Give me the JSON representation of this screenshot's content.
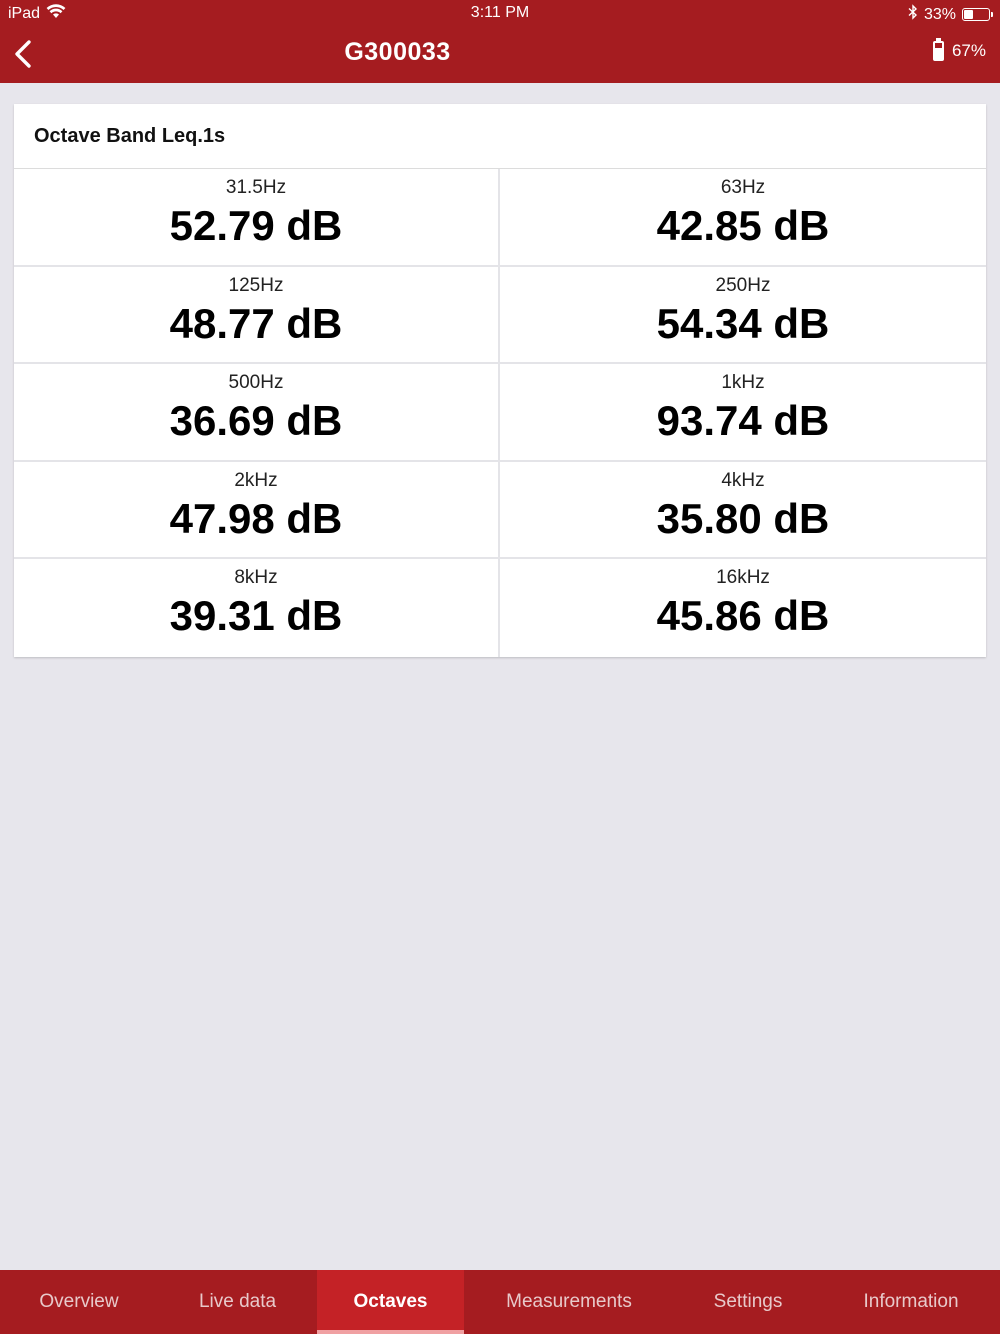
{
  "status_bar": {
    "device": "iPad",
    "time": "3:11 PM",
    "battery_text": "33%",
    "battery_level": 0.33
  },
  "nav": {
    "title": "G300033",
    "device_battery": "67%"
  },
  "card": {
    "title": "Octave Band Leq.1s",
    "bands": [
      {
        "freq": "31.5Hz",
        "level": "52.79 dB"
      },
      {
        "freq": "63Hz",
        "level": "42.85 dB"
      },
      {
        "freq": "125Hz",
        "level": "48.77 dB"
      },
      {
        "freq": "250Hz",
        "level": "54.34 dB"
      },
      {
        "freq": "500Hz",
        "level": "36.69 dB"
      },
      {
        "freq": "1kHz",
        "level": "93.74 dB"
      },
      {
        "freq": "2kHz",
        "level": "47.98 dB"
      },
      {
        "freq": "4kHz",
        "level": "35.80 dB"
      },
      {
        "freq": "8kHz",
        "level": "39.31 dB"
      },
      {
        "freq": "16kHz",
        "level": "45.86 dB"
      }
    ]
  },
  "tabs": [
    {
      "label": "Overview"
    },
    {
      "label": "Live data"
    },
    {
      "label": "Octaves"
    },
    {
      "label": "Measurements"
    },
    {
      "label": "Settings"
    },
    {
      "label": "Information"
    }
  ],
  "active_tab": "Octaves",
  "colors": {
    "brand": "#a51c20",
    "active_tab": "#c42226",
    "background": "#e7e6ec"
  }
}
